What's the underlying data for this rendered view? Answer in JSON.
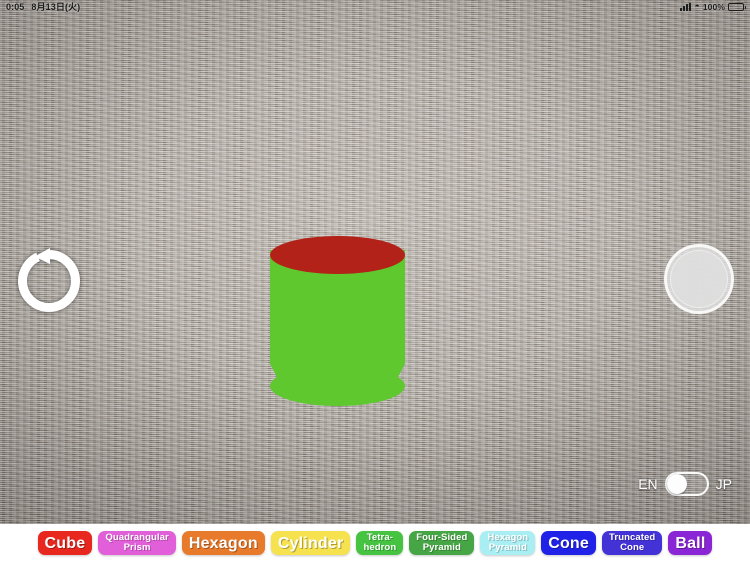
{
  "status_bar": {
    "time": "0:05",
    "date": "8月13日(火)",
    "signal_icon": "cellular-signal-icon",
    "wifi_icon": "wifi-icon",
    "battery_percent": "100%",
    "battery_icon": "battery-full-icon"
  },
  "camera": {
    "scene_description": "gray woven carpet texture",
    "reset_icon": "rotate-counterclockwise-icon",
    "capture_icon": "shutter-button-icon"
  },
  "ar_object": {
    "name": "cylinder",
    "top_color": "#b32218",
    "body_color": "#5ec82e"
  },
  "language_toggle": {
    "left_label": "EN",
    "right_label": "JP",
    "selected": "EN"
  },
  "shape_toolbar": {
    "buttons": [
      {
        "label": "Cube",
        "lines": 1,
        "bg": "#e8281e",
        "color": "#ffffff"
      },
      {
        "label": "Quadrangular\nPrism",
        "lines": 2,
        "bg": "#e15fd8",
        "color": "#ffffff"
      },
      {
        "label": "Hexagon",
        "lines": 1,
        "bg": "#e87a2c",
        "color": "#ffffff"
      },
      {
        "label": "Cylinder",
        "lines": 1,
        "bg": "#f6e14e",
        "color": "#ffffff"
      },
      {
        "label": "Tetra-\nhedron",
        "lines": 2,
        "bg": "#45c341",
        "color": "#ffffff"
      },
      {
        "label": "Four-Sided\nPyramid",
        "lines": 2,
        "bg": "#46a544",
        "color": "#ffffff"
      },
      {
        "label": "Hexagon\nPyramid",
        "lines": 2,
        "bg": "#a8eef2",
        "color": "#ffffff"
      },
      {
        "label": "Cone",
        "lines": 1,
        "bg": "#2122e8",
        "color": "#ffffff"
      },
      {
        "label": "Truncated\nCone",
        "lines": 2,
        "bg": "#4332d6",
        "color": "#ffffff"
      },
      {
        "label": "Ball",
        "lines": 1,
        "bg": "#8b26d6",
        "color": "#ffffff"
      }
    ]
  }
}
